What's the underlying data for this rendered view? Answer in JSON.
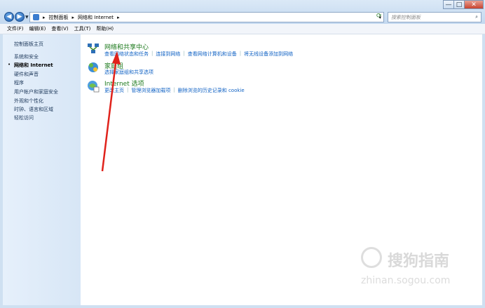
{
  "window": {
    "minimize": "—",
    "maximize": "□",
    "close": "✕"
  },
  "address": {
    "segments": [
      "控制面板",
      "网络和 Internet"
    ]
  },
  "search": {
    "placeholder": "搜索控制面板"
  },
  "menu": [
    "文件(F)",
    "编辑(E)",
    "查看(V)",
    "工具(T)",
    "帮助(H)"
  ],
  "sidebar": {
    "home": "控制面板主页",
    "items": [
      "系统和安全",
      "网络和 Internet",
      "硬件和声音",
      "程序",
      "用户帐户和家庭安全",
      "外观和个性化",
      "时钟、语言和区域",
      "轻松访问"
    ],
    "selected_index": 1
  },
  "categories": [
    {
      "title": "网络和共享中心",
      "icon": "network-center-icon",
      "links": [
        "查看网络状态和任务",
        "连接到网络",
        "查看网络计算机和设备",
        "将无线设备添加到网络"
      ]
    },
    {
      "title": "家庭组",
      "icon": "homegroup-icon",
      "links": [
        "选择家庭组和共享选项"
      ]
    },
    {
      "title": "Internet 选项",
      "icon": "internet-options-icon",
      "links": [
        "更改主页",
        "管理浏览器加载项",
        "删除浏览的历史记录和 cookie"
      ]
    }
  ],
  "watermark": {
    "text": "搜狗指南",
    "url": "zhinan.sogou.com"
  },
  "colors": {
    "accent_green": "#1d7a1d",
    "link_blue": "#1062c4",
    "arrow_red": "#e0221b"
  }
}
